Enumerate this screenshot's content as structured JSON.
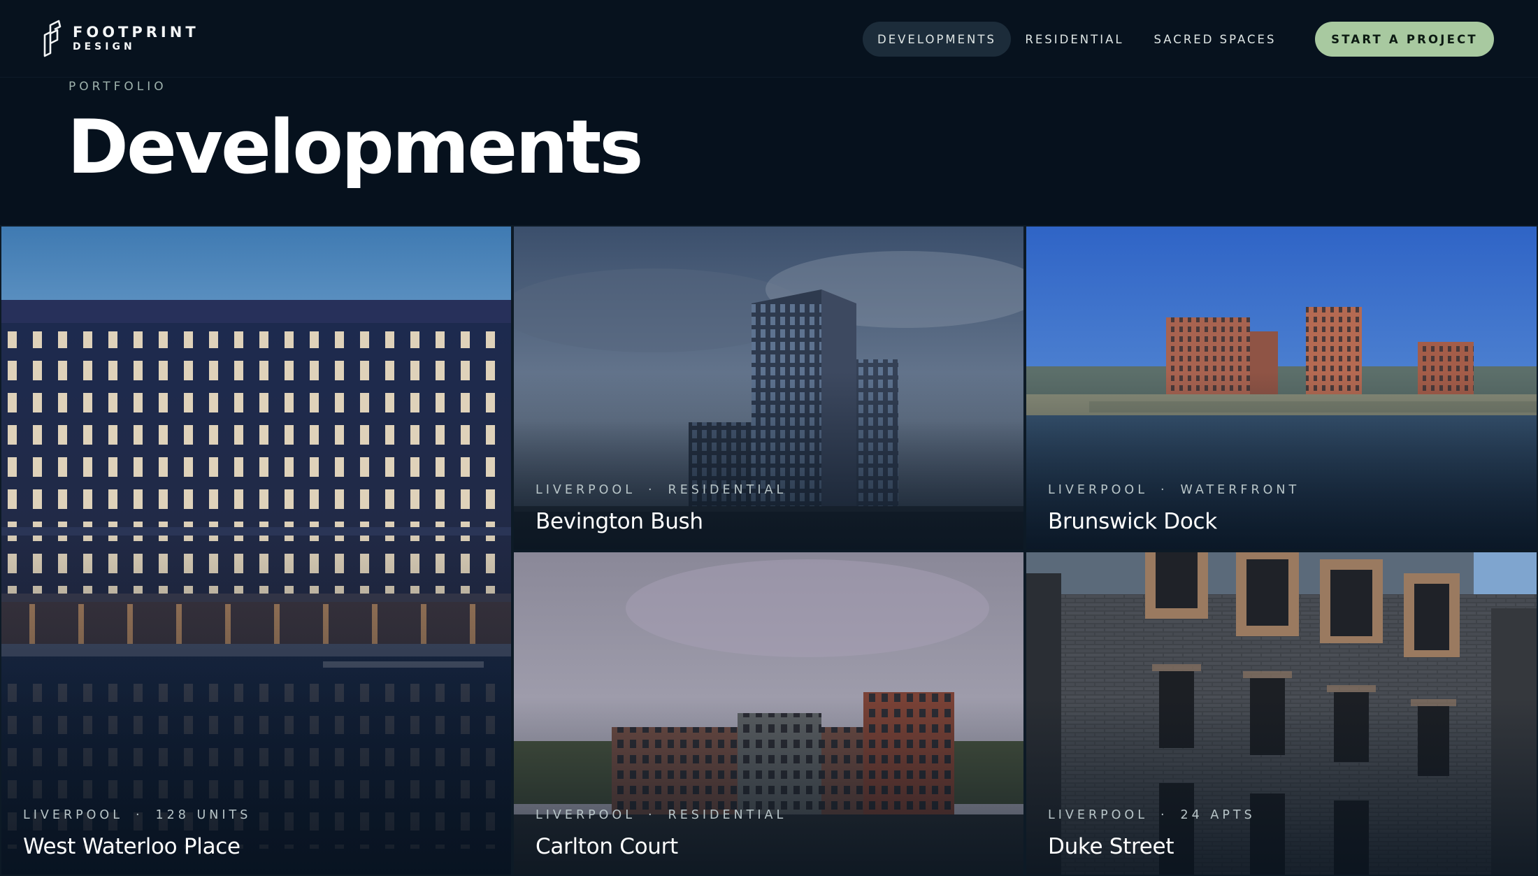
{
  "brand": {
    "name": "FOOTPRINT",
    "sub": "DESIGN"
  },
  "nav": {
    "items": [
      {
        "label": "DEVELOPMENTS",
        "active": true
      },
      {
        "label": "RESIDENTIAL",
        "active": false
      },
      {
        "label": "SACRED SPACES",
        "active": false
      }
    ],
    "cta": "START A PROJECT"
  },
  "hero": {
    "eyebrow": "PORTFOLIO",
    "title": "Developments"
  },
  "projects": [
    {
      "city": "LIVERPOOL",
      "tag": "128 UNITS",
      "title": "West Waterloo Place"
    },
    {
      "city": "LIVERPOOL",
      "tag": "RESIDENTIAL",
      "title": "Bevington Bush"
    },
    {
      "city": "LIVERPOOL",
      "tag": "WATERFRONT",
      "title": "Brunswick Dock"
    },
    {
      "city": "LIVERPOOL",
      "tag": "RESIDENTIAL",
      "title": "Carlton Court"
    },
    {
      "city": "LIVERPOOL",
      "tag": "24 APTS",
      "title": "Duke Street"
    }
  ],
  "meta_separator": "·",
  "colors": {
    "background": "#06111d",
    "accent": "#a8c9a0",
    "nav_active": "#1c2c3a"
  }
}
